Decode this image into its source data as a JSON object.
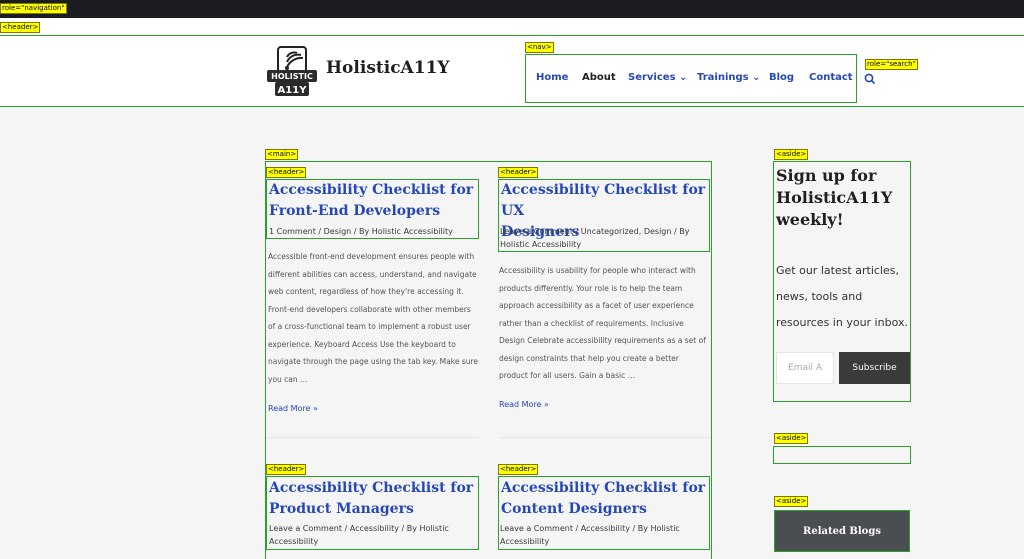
{
  "badges": {
    "role_navigation": "role=\"navigation\"",
    "header_top": "<header>",
    "nav": "<nav>",
    "role_search": "role=\"search\"",
    "main": "<main>",
    "header_1": "<header>",
    "header_2": "<header>",
    "header_3": "<header>",
    "header_4": "<header>",
    "aside_1": "<aside>",
    "aside_2": "<aside>",
    "aside_3": "<aside>"
  },
  "site": {
    "brand": "HolisticA11Y",
    "logo_line1": "HOLISTIC",
    "logo_line2": "A11Y"
  },
  "nav": {
    "items": [
      {
        "label": "Home"
      },
      {
        "label": "About"
      },
      {
        "label": "Services"
      },
      {
        "label": "Trainings"
      },
      {
        "label": "Blog"
      },
      {
        "label": "Contact"
      }
    ]
  },
  "posts": [
    {
      "title_line1": "Accessibility Checklist for",
      "title_line2": "Front-End Developers",
      "meta": "1 Comment / Design / By Holistic Accessibility",
      "excerpt": "Accessible front-end development ensures people with different abilities can access, understand, and navigate web content, regardless of how they're accessing it. Front-end developers collaborate with other members of a cross-functional team to implement a robust user experience. Keyboard Access Use the keyboard to navigate through the page using the tab key. Make sure you can …",
      "read_more": "Read More »"
    },
    {
      "title_line1": "Accessibility Checklist for UX",
      "title_line2": "Designers",
      "meta": "Leave a Comment / Uncategorized, Design / By Holistic Accessibility",
      "excerpt": "Accessibility is usability for people who interact with products differently. Your role is to help the team approach accessibility as a facet of user experience rather than a checklist of requirements. Inclusive Design Celebrate accessibility requirements as a set of design constraints that help you create a better product for all users. Gain a basic …",
      "read_more": "Read More »"
    },
    {
      "title_line1": "Accessibility Checklist for",
      "title_line2": "Product Managers",
      "meta": "Leave a Comment / Accessibility / By Holistic Accessibility"
    },
    {
      "title_line1": "Accessibility Checklist for",
      "title_line2": "Content Designers",
      "meta": "Leave a Comment / Accessibility / By Holistic Accessibility"
    }
  ],
  "sidebar": {
    "signup_title": "Sign up for HolisticA11Y weekly!",
    "signup_text": "Get our latest articles, news, tools and resources in your inbox.",
    "email_placeholder": "Email A",
    "subscribe_label": "Subscribe",
    "related_label": "Related Blogs"
  },
  "colors": {
    "link": "#2548b6",
    "outline": "#2aa22a",
    "badge": "#ffff00",
    "topbar": "#1a1c21"
  }
}
